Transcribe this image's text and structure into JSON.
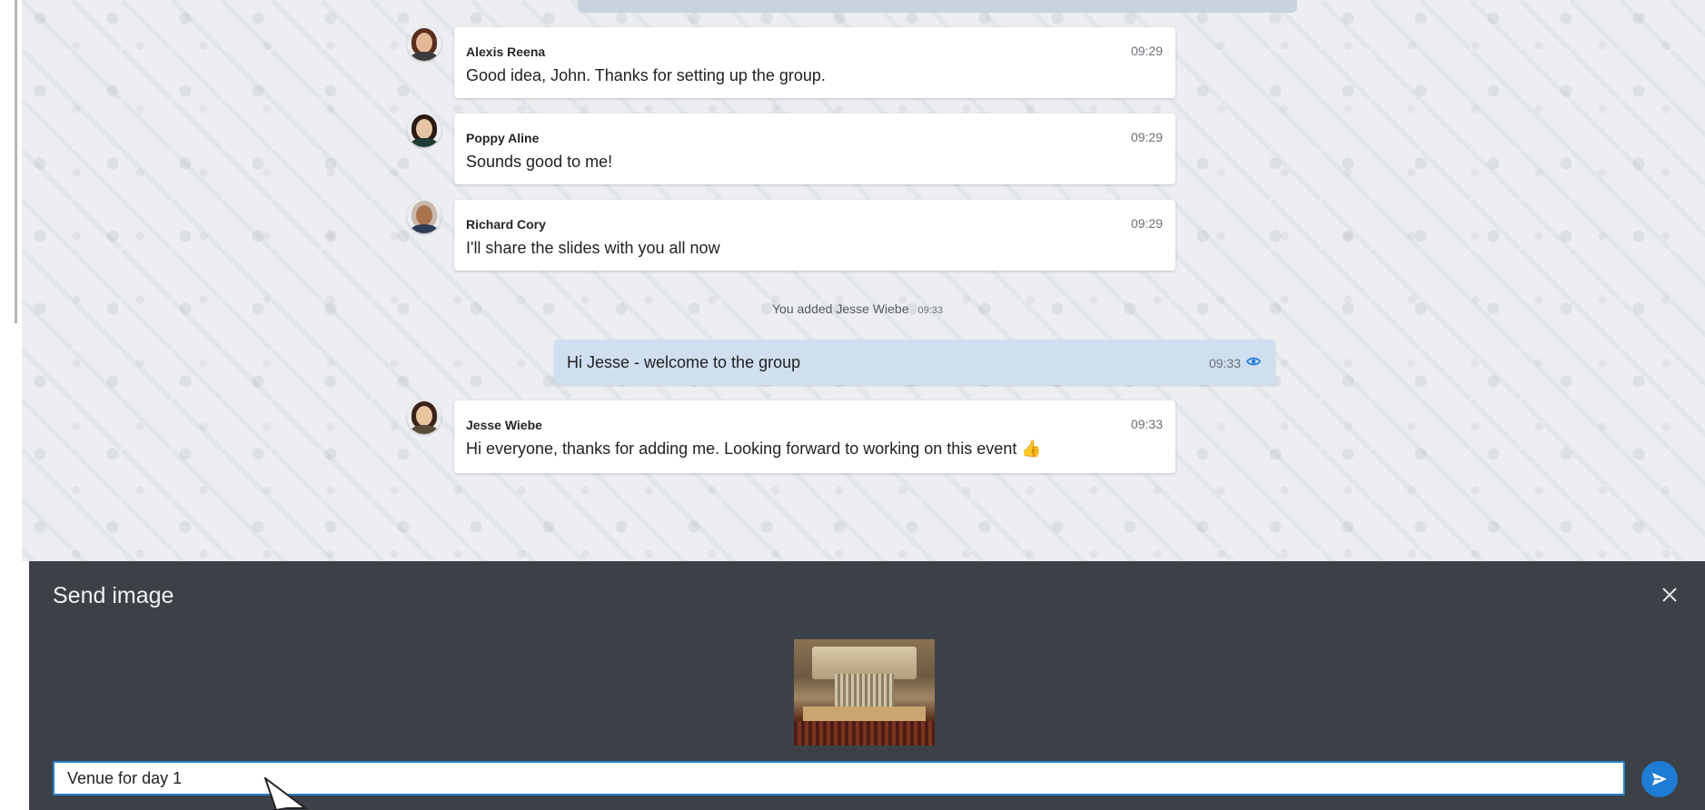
{
  "messages": [
    {
      "sender": "Alexis Reena",
      "time": "09:29",
      "text": "Good idea, John. Thanks for setting up the group."
    },
    {
      "sender": "Poppy Aline",
      "time": "09:29",
      "text": "Sounds good to me!"
    },
    {
      "sender": "Richard Cory",
      "time": "09:29",
      "text": "I'll share the slides with you all now"
    }
  ],
  "system_note": {
    "text": "You added Jesse Wiebe",
    "time": "09:33"
  },
  "own_message": {
    "text": "Hi Jesse - welcome to the group",
    "time": "09:33",
    "status_icon": "eye-icon"
  },
  "last_message": {
    "sender": "Jesse Wiebe",
    "time": "09:33",
    "text": "Hi everyone, thanks for adding me. Looking forward to working on this event",
    "emoji": "👍"
  },
  "send_image_panel": {
    "title": "Send image",
    "caption_value": "Venue for day 1",
    "close_icon": "close-icon",
    "send_icon": "send-icon"
  },
  "colors": {
    "accent": "#1e7cd4",
    "panel_bg": "#3c4147",
    "own_bubble": "#cfdff0",
    "chat_bg": "#eceef1"
  }
}
